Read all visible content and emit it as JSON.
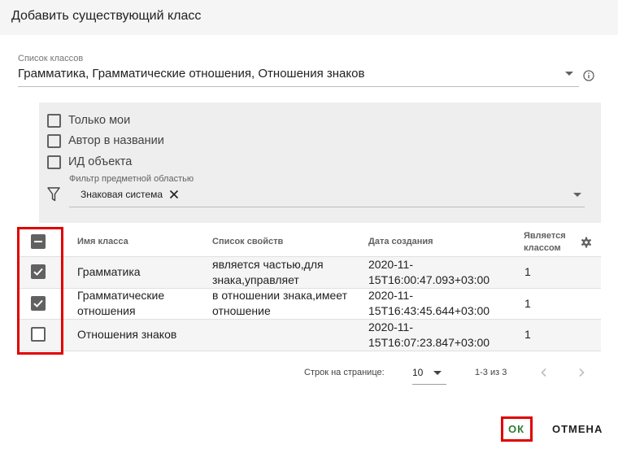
{
  "dialog": {
    "title": "Добавить существующий класс"
  },
  "class_list": {
    "label": "Список классов",
    "value": "Грамматика, Грамматические отношения, Отношения знаков",
    "info_icon": "info-icon"
  },
  "filters": {
    "only_mine": "Только мои",
    "author_in_name": "Автор в названии",
    "object_id": "ИД объекта",
    "subject_filter_label": "Фильтр предметной областью",
    "subject_chip": "Знаковая система"
  },
  "table": {
    "headers": {
      "name": "Имя класса",
      "properties": "Список свойств",
      "created": "Дата создания",
      "is_class_line1": "Является",
      "is_class_line2": "классом"
    },
    "rows": [
      {
        "checked": true,
        "name_line1": "Грамматика",
        "name_line2": "",
        "props_line1": "является частью,для",
        "props_line2": "знака,управляет",
        "date_line1": "2020-11-",
        "date_line2": "15T16:00:47.093+03:00",
        "is_class": "1"
      },
      {
        "checked": true,
        "name_line1": "Грамматические",
        "name_line2": "отношения",
        "props_line1": "в отношении знака,имеет",
        "props_line2": "отношение",
        "date_line1": "2020-11-",
        "date_line2": "15T16:43:45.644+03:00",
        "is_class": "1"
      },
      {
        "checked": false,
        "name_line1": "Отношения знаков",
        "name_line2": "",
        "props_line1": "",
        "props_line2": "",
        "date_line1": "2020-11-",
        "date_line2": "15T16:07:23.847+03:00",
        "is_class": "1"
      }
    ]
  },
  "pagination": {
    "rows_per_page_label": "Строк на странице:",
    "rows_per_page": "10",
    "range": "1-3 из 3"
  },
  "actions": {
    "ok": "ОК",
    "cancel": "ОТМЕНА"
  },
  "colors": {
    "accent": "#2e7d32",
    "highlight": "#e00000",
    "checkbox": "#616161"
  }
}
